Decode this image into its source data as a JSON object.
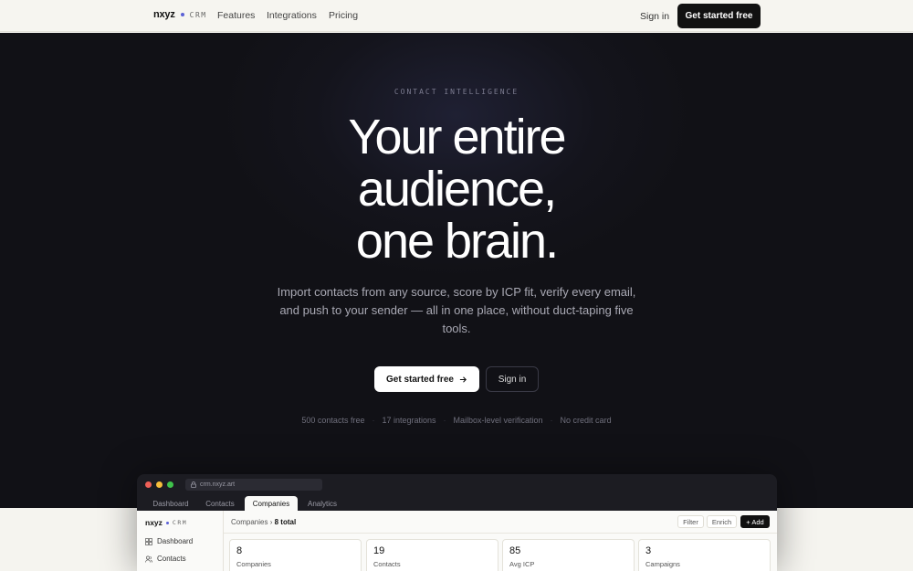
{
  "nav": {
    "brand": "nxyz",
    "brand_tag": "CRM",
    "links": [
      "Features",
      "Integrations",
      "Pricing"
    ],
    "sign_in": "Sign in",
    "cta": "Get started free"
  },
  "hero": {
    "eyebrow": "CONTACT INTELLIGENCE",
    "headline_lines": [
      "Your entire",
      "audience,",
      "one brain."
    ],
    "subtitle": "Import contacts from any source, score by ICP fit, verify every email, and push to your sender — all in one place, without duct-taping five tools.",
    "primary_cta": "Get started free",
    "secondary_cta": "Sign in",
    "features": [
      "500 contacts free",
      "17 integrations",
      "Mailbox-level verification",
      "No credit card"
    ],
    "separator": "·"
  },
  "preview": {
    "url": "crm.nxyz.art",
    "tabs": [
      "Dashboard",
      "Contacts",
      "Companies",
      "Analytics"
    ],
    "active_tab": "Companies",
    "brand": "nxyz",
    "brand_tag": "CRM",
    "sidebar_items": [
      "Dashboard",
      "Contacts"
    ],
    "breadcrumb_root": "Companies",
    "breadcrumb_sep": "›",
    "breadcrumb_count": "8 total",
    "actions": [
      "Filter",
      "Enrich",
      "+ Add"
    ],
    "stats": [
      {
        "value": "8",
        "label": "Companies"
      },
      {
        "value": "19",
        "label": "Contacts"
      },
      {
        "value": "85",
        "label": "Avg ICP"
      },
      {
        "value": "3",
        "label": "Campaigns"
      }
    ]
  },
  "colors": {
    "accent": "#5b61d6",
    "hero_bg": "#111116",
    "page_bg": "#f5f4ef"
  }
}
